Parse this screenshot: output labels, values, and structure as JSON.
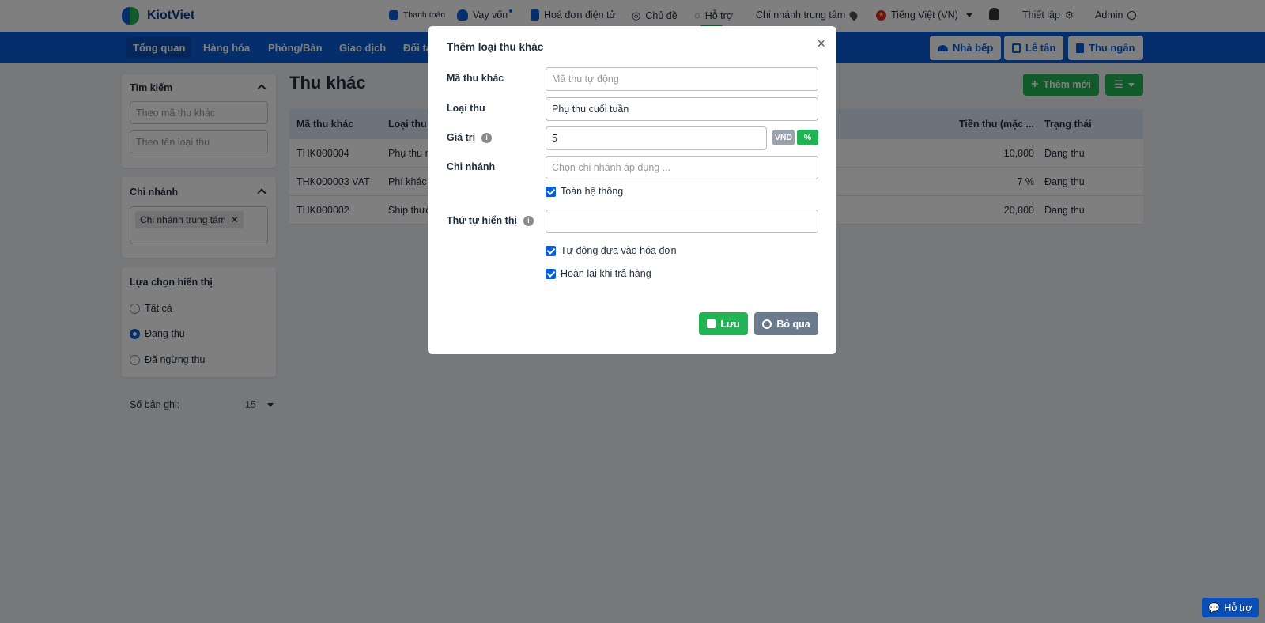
{
  "brand": {
    "name": "KiotViet",
    "blue": "#0a5fd8",
    "green": "#22b454"
  },
  "topbar": {
    "payment": "Thanh toán",
    "loan": "Vay vốn",
    "einvoice": "Hoá đơn điện tử",
    "theme": "Chủ đề",
    "support": "Hỗ trợ",
    "branch": "Chi nhánh trung tâm",
    "language": "Tiếng Việt (VN)",
    "settings": "Thiết lập",
    "user": "Admin"
  },
  "mainnav": {
    "items": [
      "Tổng quan",
      "Hàng hóa",
      "Phòng/Bàn",
      "Giao dịch",
      "Đối tá"
    ],
    "kitchen": "Nhà bếp",
    "reception": "Lễ tân",
    "cashier": "Thu ngân"
  },
  "sidebar": {
    "search_title": "Tìm kiếm",
    "search_code_placeholder": "Theo mã thu khác",
    "search_type_placeholder": "Theo tên loại thu",
    "branch_title": "Chi nhánh",
    "branch_tag": "Chi nhánh trung tâm",
    "display_title": "Lựa chọn hiển thị",
    "options": [
      "Tất cả",
      "Đang thu",
      "Đã ngừng thu"
    ],
    "selected_option": "Đang thu",
    "records_label": "Số bản ghi:",
    "records_value": "15"
  },
  "content": {
    "title": "Thu khác",
    "add_button": "Thêm mới",
    "columns": [
      "Mã thu khác",
      "Loại thu",
      "Tiền thu (mặc ...",
      "Trạng thái"
    ],
    "rows": [
      {
        "code": "THK000004",
        "type": "Phụ thu n",
        "amount": "10,000",
        "status": "Đang thu"
      },
      {
        "code": "THK000003 VAT",
        "type": "Phí khác",
        "amount": "7 %",
        "status": "Đang thu"
      },
      {
        "code": "THK000002",
        "type": "Ship thườ",
        "amount": "20,000",
        "status": "Đang thu"
      }
    ]
  },
  "modal": {
    "title": "Thêm loại thu khác",
    "code_label": "Mã thu khác",
    "code_placeholder": "Mã thu tự động",
    "type_label": "Loại thu",
    "type_value": "Phụ thu cuối tuần",
    "value_label": "Giá trị",
    "value_value": "5",
    "unit_vnd": "VND",
    "unit_pct": "%",
    "selected_unit": "%",
    "branch_label": "Chi nhánh",
    "branch_placeholder": "Chọn chi nhánh áp dụng ...",
    "system_wide": "Toàn hệ thống",
    "order_label": "Thứ tự hiển thị",
    "order_value": "",
    "auto_invoice": "Tự động đưa vào hóa đơn",
    "refund_on_return": "Hoàn lại khi trả hàng",
    "save": "Lưu",
    "skip": "Bỏ qua"
  },
  "help_float": "Hỗ trợ"
}
